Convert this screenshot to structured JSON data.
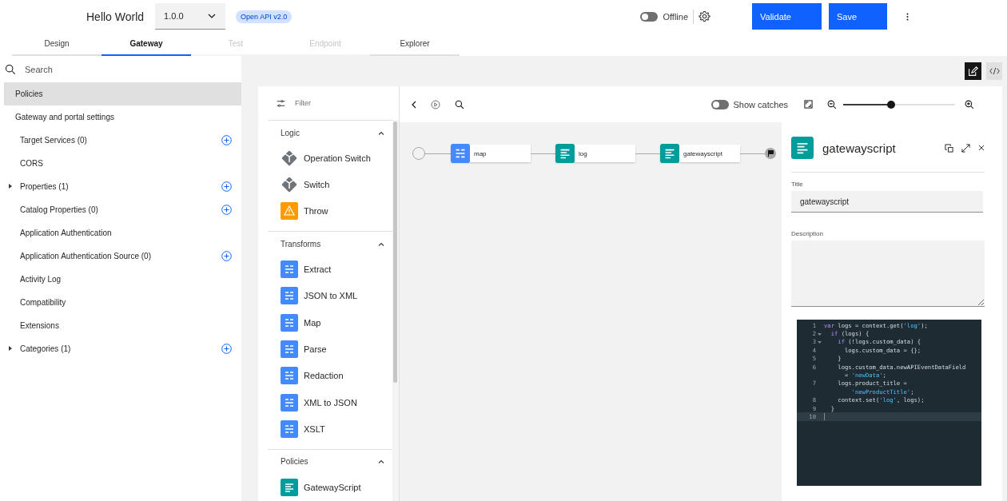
{
  "header": {
    "title": "Hello World",
    "version": "1.0.0",
    "badge": "Open API v2.0",
    "offline_toggle": {
      "label": "Offline",
      "on": false
    },
    "buttons": [
      "Validate",
      "Save"
    ]
  },
  "tabs": [
    {
      "label": "Design",
      "selected": false,
      "disabled": false
    },
    {
      "label": "Gateway",
      "selected": true,
      "disabled": false
    },
    {
      "label": "Test",
      "selected": false,
      "disabled": true
    },
    {
      "label": "Endpoint",
      "selected": false,
      "disabled": true
    },
    {
      "label": "Explorer",
      "selected": false,
      "disabled": false
    }
  ],
  "sidebar": {
    "search": {
      "placeholder": "Search"
    },
    "items": [
      {
        "label": "Policies",
        "selected": true
      },
      {
        "label": "Gateway and portal settings",
        "selected": false,
        "children": [
          {
            "label": "Target Services (0)",
            "selected": false,
            "expandable": false,
            "addable": true
          },
          {
            "label": "CORS",
            "selected": false,
            "expandable": false,
            "addable": false
          },
          {
            "label": "Properties (1)",
            "selected": false,
            "expandable": true,
            "addable": true
          },
          {
            "label": "Catalog Properties (0)",
            "selected": false,
            "expandable": false,
            "addable": true
          },
          {
            "label": "Application Authentication",
            "selected": false,
            "expandable": false,
            "addable": false
          },
          {
            "label": "Application Authentication Source (0)",
            "selected": false,
            "expandable": false,
            "addable": true
          },
          {
            "label": "Activity Log",
            "selected": false,
            "expandable": false,
            "addable": false
          },
          {
            "label": "Compatibility",
            "selected": false,
            "expandable": false,
            "addable": false
          },
          {
            "label": "Extensions",
            "selected": false,
            "expandable": false,
            "addable": false
          },
          {
            "label": "Categories (1)",
            "selected": false,
            "expandable": true,
            "addable": true
          }
        ]
      }
    ]
  },
  "palette": {
    "filter": {
      "placeholder": "Filter"
    },
    "groups": [
      {
        "title": "Logic",
        "expanded": true,
        "items": [
          {
            "label": "Operation Switch",
            "kind": "logic"
          },
          {
            "label": "Switch",
            "kind": "logic"
          },
          {
            "label": "Throw",
            "kind": "throw"
          }
        ]
      },
      {
        "title": "Transforms",
        "expanded": true,
        "items": [
          {
            "label": "Extract",
            "kind": "transform"
          },
          {
            "label": "JSON to XML",
            "kind": "transform"
          },
          {
            "label": "Map",
            "kind": "transform"
          },
          {
            "label": "Parse",
            "kind": "transform"
          },
          {
            "label": "Redaction",
            "kind": "transform"
          },
          {
            "label": "XML to JSON",
            "kind": "transform"
          },
          {
            "label": "XSLT",
            "kind": "transform"
          }
        ]
      },
      {
        "title": "Policies",
        "expanded": true,
        "items": [
          {
            "label": "GatewayScript",
            "kind": "policy"
          }
        ]
      }
    ]
  },
  "canvas_toolbar": {
    "show_catches": {
      "label": "Show catches",
      "on": false
    },
    "zoom": {
      "level": 0.43
    }
  },
  "flow": [
    {
      "label": "map",
      "kind": "transform"
    },
    {
      "label": "log",
      "kind": "policy"
    },
    {
      "label": "gatewayscript",
      "kind": "policy"
    }
  ],
  "properties": {
    "title": "gatewayscript",
    "fields": [
      {
        "label": "Title",
        "value": "gatewayscript",
        "kind": "input"
      },
      {
        "label": "Description",
        "kind": "textarea"
      }
    ],
    "code": [
      {
        "number": "1",
        "fold": false,
        "active": false,
        "segments": [
          {
            "text": "var",
            "kind": "keyword"
          },
          {
            "text": " logs = context.get(",
            "kind": "plain"
          },
          {
            "text": "'log'",
            "kind": "string"
          },
          {
            "text": ");",
            "kind": "plain"
          }
        ]
      },
      {
        "number": "2",
        "fold": true,
        "active": false,
        "segments": [
          {
            "text": "  if",
            "kind": "keyword"
          },
          {
            "text": " (logs) {",
            "kind": "plain"
          }
        ]
      },
      {
        "number": "3",
        "fold": true,
        "active": false,
        "segments": [
          {
            "text": "    if",
            "kind": "keyword"
          },
          {
            "text": " (!logs.custom_data) {",
            "kind": "plain"
          }
        ]
      },
      {
        "number": "4",
        "fold": false,
        "active": false,
        "segments": [
          {
            "text": "      logs.custom_data = {};",
            "kind": "plain"
          }
        ]
      },
      {
        "number": "5",
        "fold": false,
        "active": false,
        "segments": [
          {
            "text": "    }",
            "kind": "plain"
          }
        ]
      },
      {
        "number": "6",
        "fold": false,
        "active": false,
        "segments": [
          {
            "text": "    logs.custom_data.newAPIEventDataField",
            "kind": "plain"
          }
        ]
      },
      {
        "fold": false,
        "active": false,
        "segments": [
          {
            "text": "      = ",
            "kind": "plain"
          },
          {
            "text": "'newData'",
            "kind": "string"
          },
          {
            "text": ";",
            "kind": "plain"
          }
        ]
      },
      {
        "number": "7",
        "fold": false,
        "active": false,
        "segments": [
          {
            "text": "    logs.product_title =",
            "kind": "plain"
          }
        ]
      },
      {
        "fold": false,
        "active": false,
        "segments": [
          {
            "text": "        'newProductTitle'",
            "kind": "string"
          },
          {
            "text": ";",
            "kind": "plain"
          }
        ]
      },
      {
        "number": "8",
        "fold": false,
        "active": false,
        "segments": [
          {
            "text": "    context.set(",
            "kind": "plain"
          },
          {
            "text": "'log'",
            "kind": "string"
          },
          {
            "text": ", logs);",
            "kind": "plain"
          }
        ]
      },
      {
        "number": "9",
        "fold": false,
        "active": false,
        "segments": [
          {
            "text": "  }",
            "kind": "plain"
          }
        ]
      },
      {
        "number": "10",
        "fold": false,
        "active": true
      }
    ]
  }
}
